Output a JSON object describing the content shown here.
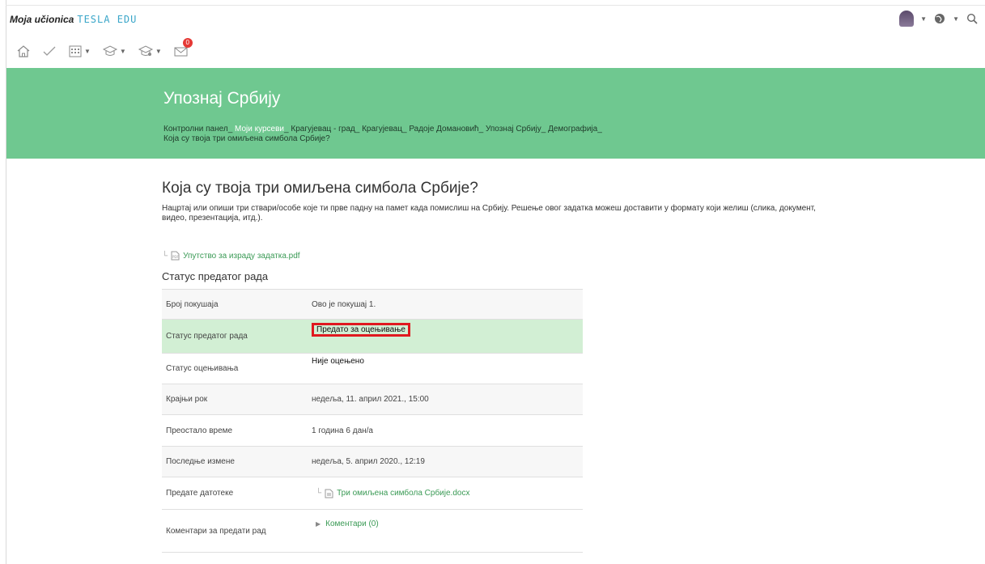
{
  "brand": {
    "name": "Moja učionica",
    "product": "TESLA EDU"
  },
  "header": {
    "notifications_count": "0"
  },
  "course": {
    "title": "Упознај Србију",
    "breadcrumb": [
      "Контролни панел",
      "Моји курсеви",
      "Крагујевац - град",
      "Крагујевац",
      "Радоје Домановић",
      "Упознај Србију",
      "Демографија"
    ],
    "breadcrumb_last": "Која су твоја три омиљена симбола Србије?"
  },
  "assignment": {
    "title": "Која су твоја три омиљена симбола Србије?",
    "intro": "Нацртај или опиши три ствари/особе које ти прве падну на памет када помислиш на Србију. Решење овог задатка можеш доставити у формату који желиш (слика, документ, видео, презентација, итд.).",
    "attachment": "Упутство за израду задатка.pdf"
  },
  "submission": {
    "section_title": "Статус предатог рада",
    "rows": [
      {
        "label": "Број покушаја",
        "value": "Ово је покушај 1."
      },
      {
        "label": "Статус предатог рада",
        "value": "Предато за оцењивање"
      },
      {
        "label": "Статус оцењивања",
        "value": "Није оцењено"
      },
      {
        "label": "Крајњи рок",
        "value": "недеља, 11. април 2021., 15:00"
      },
      {
        "label": "Преостало време",
        "value": "1 година 6 дан/а"
      },
      {
        "label": "Последње измене",
        "value": "недеља, 5. април 2020., 12:19"
      },
      {
        "label": "Предате датотеке",
        "value": "Три омиљена симбола Србије.docx"
      },
      {
        "label": "Коментари за предати рад",
        "value": "Коментари (0)"
      }
    ]
  },
  "colors": {
    "hero": "#6fc890",
    "link": "#3a9a55",
    "highlight_row": "#d2efd4",
    "mark": "#e0191f"
  }
}
